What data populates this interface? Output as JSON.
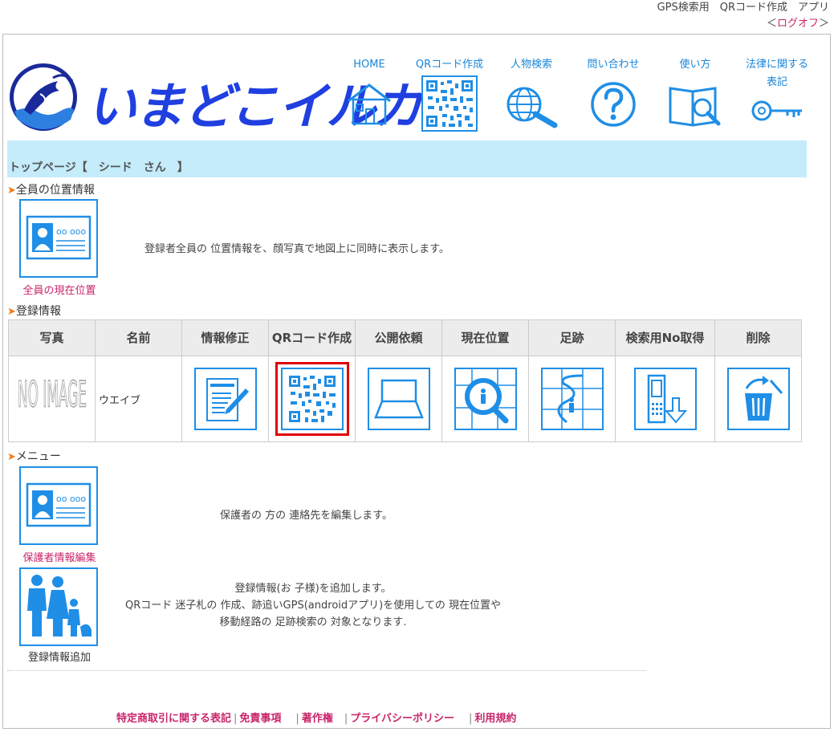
{
  "header": {
    "app_name": "GPS検索用　QRコード作成　アプリ",
    "logoff": "ログオフ",
    "bracket_left": "＜",
    "bracket_right": "＞"
  },
  "logo": {
    "text": "いまどこイルカ"
  },
  "nav": [
    {
      "label": "HOME",
      "icon": "house-icon"
    },
    {
      "label": "QRコード作成",
      "icon": "qr-code-icon"
    },
    {
      "label": "人物検索",
      "icon": "globe-search-icon"
    },
    {
      "label": "問い合わせ",
      "icon": "question-icon"
    },
    {
      "label": "使い方",
      "icon": "book-search-icon"
    },
    {
      "label": "法律に関する",
      "label2": "表記",
      "icon": "key-icon"
    }
  ],
  "breadcrumb": "トップページ【　シード　さん　】",
  "section_all": {
    "title": "全員の位置情報",
    "card_label": "全員の現在位置",
    "description": "登録者全員の 位置情報を、顔写真で地図上に同時に表示します。"
  },
  "section_reg": {
    "title": "登録情報",
    "columns": [
      "写真",
      "名前",
      "情報修正",
      "QRコード作成",
      "公開依頼",
      "現在位置",
      "足跡",
      "検索用No取得",
      "削除"
    ],
    "row": {
      "photo": "NO IMAGE",
      "name": "ウエイブ"
    }
  },
  "section_menu": {
    "title": "メニュー",
    "items": [
      {
        "label": "保護者情報編集",
        "description": [
          "保護者の 方の 連絡先を編集します。"
        ]
      },
      {
        "label": "登録情報追加",
        "description": [
          "登録情報(お 子様)を追加します。",
          "QRコード 迷子札の 作成、跡追いGPS(androidアプリ)を使用しての 現在位置や",
          "移動経路の 足跡検索の 対象となります."
        ]
      }
    ]
  },
  "footer": {
    "links": [
      "特定商取引に関する表記",
      "免責事項",
      "著作権",
      "プライバシーポリシー",
      "利用規約"
    ]
  },
  "colors": {
    "accent": "#1f8ee6",
    "link": "#c8256b",
    "nav_link": "#1a86d8",
    "banner": "#c4ecfb",
    "highlight": "#e00000"
  }
}
